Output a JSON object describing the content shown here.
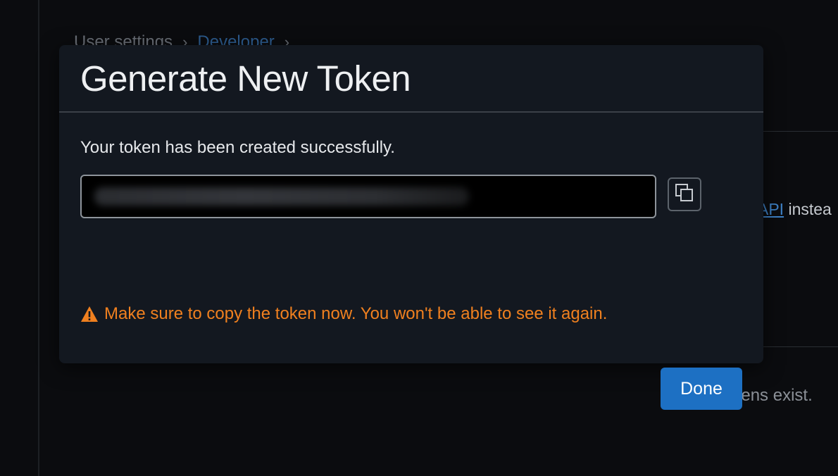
{
  "background": {
    "breadcrumb": {
      "item1": "User settings",
      "separator": "›",
      "item2": "Developer"
    },
    "api_link_text": "API",
    "api_trailing_text": " instea",
    "empty_state": "No tokens exist."
  },
  "modal": {
    "title": "Generate New Token",
    "success_message": "Your token has been created successfully.",
    "token_field": {
      "value": "",
      "obscured": true
    },
    "copy_button": {
      "icon": "copy-icon"
    },
    "warning": {
      "icon": "warning-triangle-icon",
      "text": "Make sure to copy the token now. You won't be able to see it again."
    },
    "done_label": "Done"
  },
  "colors": {
    "page_background": "#0b0c0f",
    "modal_background": "#131820",
    "warning": "#f0801f",
    "primary_button": "#1d70c3",
    "link": "#3e82c7"
  }
}
